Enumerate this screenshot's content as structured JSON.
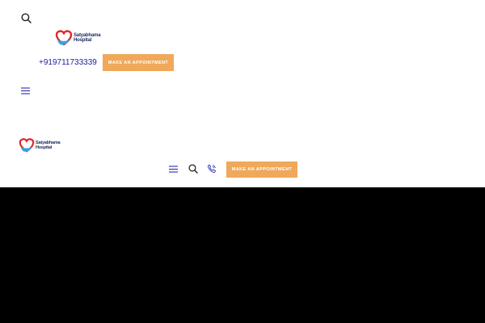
{
  "colors": {
    "accent": "#f0a85a",
    "phone_text": "#1d1d9e",
    "icon": "#2b2bb0",
    "logo_text": "#1b2a5c",
    "logo_heart_red": "#e1262b",
    "logo_heart_blue": "#3aa0dc"
  },
  "mobile_header": {
    "search_icon": "search-icon",
    "logo": {
      "line1": "Satyabhama",
      "line2": "Hospital"
    },
    "phone": "+919711733339",
    "appointment_button": "MAKE AN APPOINTMENT",
    "menu_icon": "hamburger-menu-icon"
  },
  "sticky_header": {
    "logo": {
      "line1": "Satyabhama",
      "line2": "Hospital"
    },
    "menu_icon": "hamburger-menu-icon",
    "search_icon": "search-icon",
    "phone_icon": "phone-call-icon",
    "appointment_button": "MAKE AN APPOINTMENT"
  }
}
